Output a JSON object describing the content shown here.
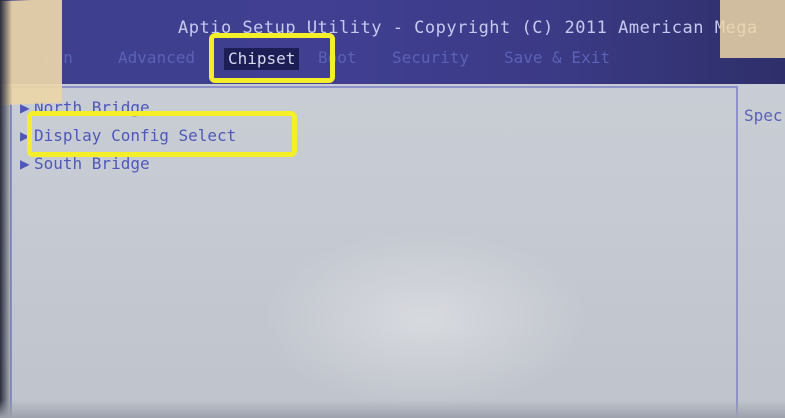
{
  "header": {
    "title": "Aptio Setup Utility - Copyright (C) 2011 American Mega"
  },
  "menu": [
    {
      "label": "ain"
    },
    {
      "label": "Advanced"
    },
    {
      "label": "Chipset",
      "active": true
    },
    {
      "label": "Boot"
    },
    {
      "label": "Security"
    },
    {
      "label": "Save & Exit"
    }
  ],
  "main": {
    "items": [
      {
        "label": "North Bridge"
      },
      {
        "label": "Display Config Select",
        "selected": true
      },
      {
        "label": "South Bridge"
      }
    ]
  },
  "help": {
    "text": "Spec"
  },
  "colors": {
    "highlight": "#f5ef2a",
    "header": "#3d3f8c",
    "screen": "#c7cbd3"
  }
}
